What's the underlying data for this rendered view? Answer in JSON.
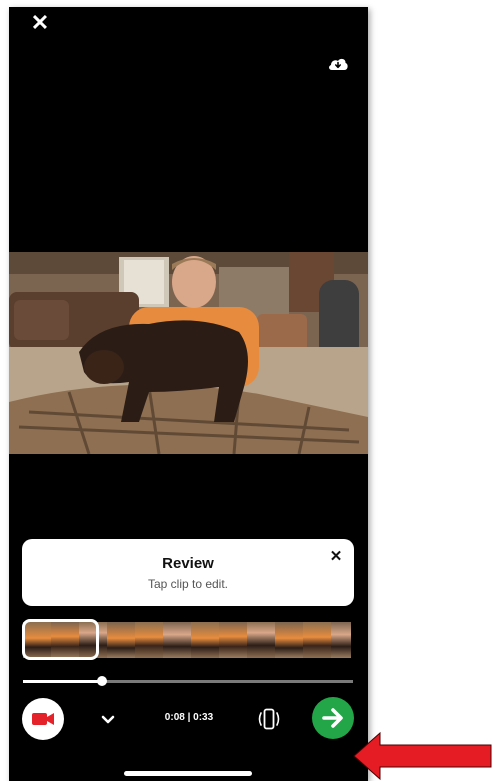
{
  "header": {
    "close_icon": "close-icon",
    "cloud_icon": "cloud-download-icon"
  },
  "review": {
    "title": "Review",
    "subtitle": "Tap clip to edit.",
    "close_icon": "close-icon"
  },
  "playback": {
    "progress_fraction": 0.24,
    "time_text": "0:08 | 0:33"
  },
  "controls": {
    "record_icon": "video-camera-icon",
    "chevron_icon": "chevron-down-icon",
    "rotate_icon": "rotate-device-icon",
    "next_icon": "arrow-right-icon"
  },
  "colors": {
    "accent_green": "#22a647",
    "record_red": "#e4222a",
    "annotation_arrow": "#e51c23"
  }
}
